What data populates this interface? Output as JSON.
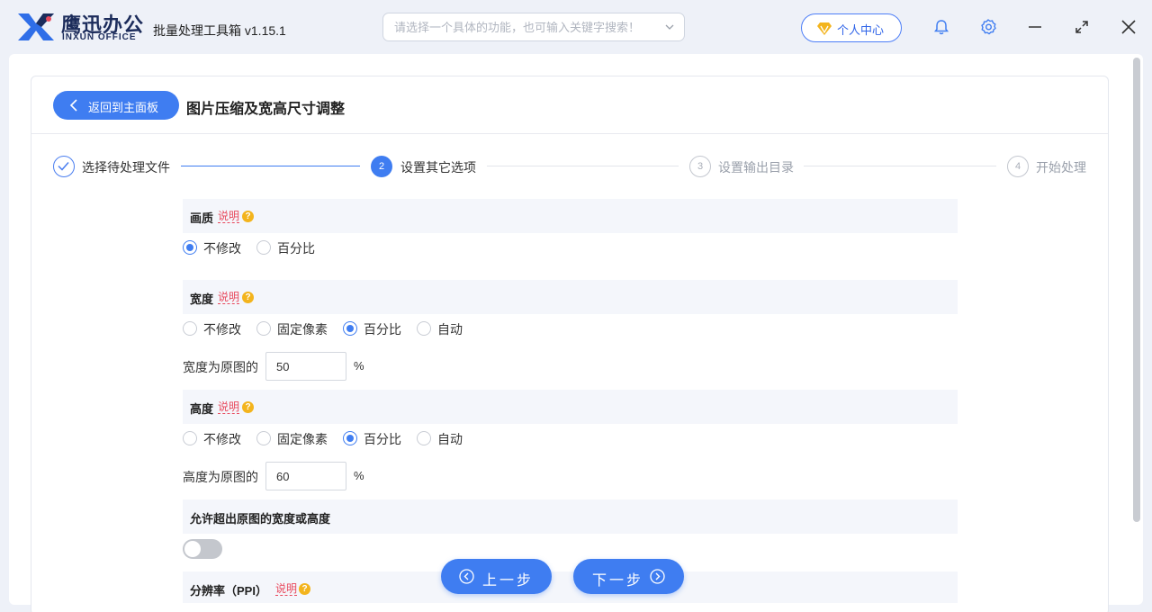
{
  "app": {
    "brand_cn": "鹰迅办公",
    "brand_en": "INXUN OFFICE",
    "title": "批量处理工具箱 v1.15.1",
    "search_placeholder": "请选择一个具体的功能，也可输入关键字搜索！",
    "user_center": "个人中心",
    "icons": [
      "bell-icon",
      "gear-icon",
      "minimize-icon",
      "maximize-icon",
      "close-icon"
    ]
  },
  "colors": {
    "accent": "#3f7df1",
    "help": "#e8485c",
    "question": "#f3b41d"
  },
  "page": {
    "back_label": "返回到主面板",
    "title": "图片压缩及宽高尺寸调整"
  },
  "steps": [
    {
      "num": "1",
      "label": "选择待处理文件",
      "state": "done"
    },
    {
      "num": "2",
      "label": "设置其它选项",
      "state": "active"
    },
    {
      "num": "3",
      "label": "设置输出目录",
      "state": "idle"
    },
    {
      "num": "4",
      "label": "开始处理",
      "state": "idle"
    }
  ],
  "form": {
    "help_text": "说明",
    "quality": {
      "title": "画质",
      "options": [
        "不修改",
        "百分比"
      ],
      "selected": "不修改"
    },
    "width": {
      "title": "宽度",
      "options": [
        "不修改",
        "固定像素",
        "百分比",
        "自动"
      ],
      "selected": "百分比",
      "field_label": "宽度为原图的",
      "value": "50",
      "unit": "%"
    },
    "height": {
      "title": "高度",
      "options": [
        "不修改",
        "固定像素",
        "百分比",
        "自动"
      ],
      "selected": "百分比",
      "field_label": "高度为原图的",
      "value": "60",
      "unit": "%"
    },
    "allow_exceed": {
      "title": "允许超出原图的宽度或高度",
      "enabled": false
    },
    "resolution": {
      "title": "分辨率（PPI）"
    }
  },
  "nav": {
    "prev": "上一步",
    "next": "下一步"
  }
}
